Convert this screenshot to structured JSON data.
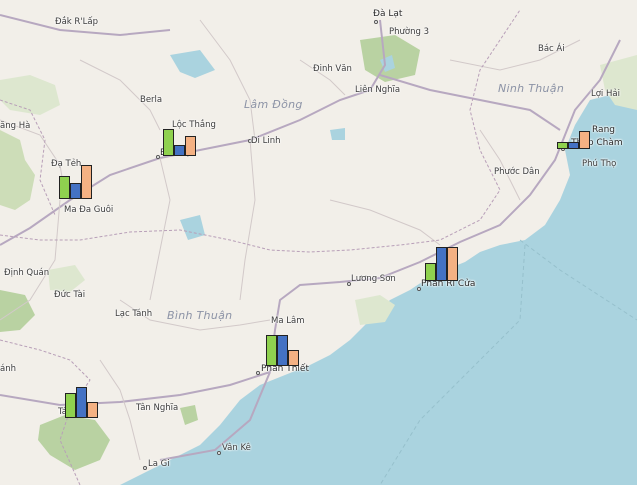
{
  "map": {
    "colors": {
      "land": "#f2efe9",
      "sea": "#aad3df",
      "forest": "#cdddb8",
      "water": "#aad3df",
      "road": "#c8b8c8",
      "series": [
        "#8fd14f",
        "#4472c4",
        "#f4b183"
      ]
    },
    "regions": {
      "lam_dong": "Lâm Đồng",
      "binh_thuan": "Bình Thuận",
      "ninh_thuan": "Ninh Thuận"
    },
    "places": {
      "da_lat": "Đà Lạt",
      "phuong3": "Phường 3",
      "dak_rlap": "Đắk R'Lấp",
      "dinh_van": "Đinh Văn",
      "lien_nghia": "Liên Nghĩa",
      "berla": "Berla",
      "loc_thang": "Lộc Thắng",
      "bao_loc": "Bảo Lộc",
      "di_linh": "Di Linh",
      "ang_ha": "ăng Hà",
      "da_teh": "Đạ Tẻh",
      "ma_da_guoi": "Ma Đa Guôi",
      "dinh_quan": "Định Quán",
      "duc_tai": "Đức Tài",
      "lac_tanh": "Lạc Tánh",
      "ma_lam": "Ma Lâm",
      "phan_thiet": "Phan Thiết",
      "luong_son": "Lương Sơn",
      "phan_ri_cua": "Phan Rí Cửa",
      "bac_ai": "Bác Ái",
      "loi_hai": "Lợi Hải",
      "rang": "Rang",
      "thap_cham": "- Tháp Chàm",
      "phu_tho": "Phú Thọ",
      "phuoc_dan": "Phước Dân",
      "tan_nghia": "Tân Nghĩa",
      "ta": "Tá",
      "anh": "ánh",
      "van_ke": "Vân Kê",
      "la_gi": "La Gi"
    },
    "charts": [
      {
        "place": "Bảo Lộc",
        "values": [
          0.75,
          0.3,
          0.55
        ]
      },
      {
        "place": "Ma Đa Guôi",
        "values": [
          0.65,
          0.45,
          0.95
        ]
      },
      {
        "place": "Phan Rí Cửa",
        "values": [
          0.5,
          0.95,
          0.95
        ]
      },
      {
        "place": "Phan Rang - Tháp Chàm",
        "values": [
          0.2,
          0.2,
          0.5
        ]
      },
      {
        "place": "Phan Thiết",
        "values": [
          0.85,
          0.85,
          0.45
        ]
      },
      {
        "place": "Tánh Linh",
        "values": [
          0.7,
          0.85,
          0.45
        ]
      }
    ]
  }
}
